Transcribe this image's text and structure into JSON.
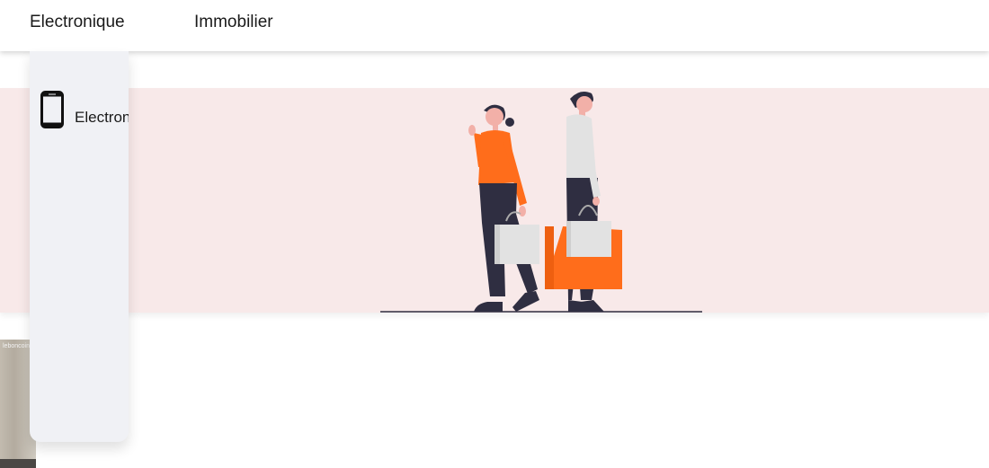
{
  "nav": {
    "items": [
      {
        "label": "Electronique"
      },
      {
        "label": "Immobilier"
      }
    ]
  },
  "dropdown": {
    "items": [
      {
        "label": "Electronique",
        "icon": "smartphone-icon"
      }
    ]
  },
  "banner": {
    "illustration": "shopping-people-illustration",
    "colors": {
      "background": "#f8e9e9",
      "accent": "#ff6d1b",
      "dark": "#2f2e41",
      "light": "#e2e2e2"
    }
  },
  "thumbnail": {
    "label": "leboncoin"
  }
}
